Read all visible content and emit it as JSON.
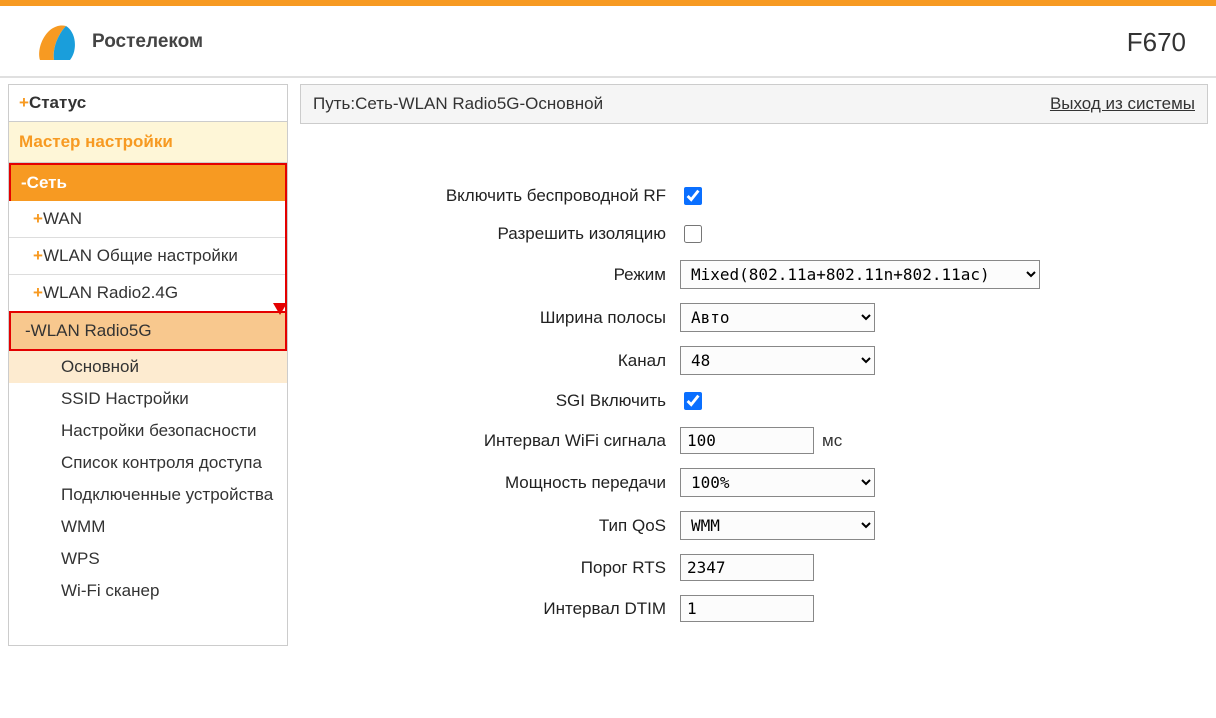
{
  "brand": "Ростелеком",
  "model": "F670",
  "sidebar": {
    "status": "Статус",
    "wizard": "Мастер настройки",
    "network": "Сеть",
    "wan": "WAN",
    "wlan_common": "WLAN Общие настройки",
    "wlan24": "WLAN Radio2.4G",
    "wlan5g": "WLAN Radio5G",
    "leaves": {
      "basic": "Основной",
      "ssid": "SSID Настройки",
      "security": "Настройки безопасности",
      "acl": "Список контроля доступа",
      "devices": "Подключенные устройства",
      "wmm": "WMM",
      "wps": "WPS",
      "scanner": "Wi-Fi сканер"
    }
  },
  "breadcrumb": "Путь:Сеть-WLAN Radio5G-Основной",
  "logout": "Выход из системы",
  "labels": {
    "rf": "Включить беспроводной RF",
    "isolation": "Разрешить изоляцию",
    "mode": "Режим",
    "bandwidth": "Ширина полосы",
    "channel": "Канал",
    "sgi": "SGI Включить",
    "beacon": "Интервал WiFi сигнала",
    "beacon_unit": "мс",
    "tx_power": "Мощность передачи",
    "qos": "Тип QoS",
    "rts": "Порог RTS",
    "dtim": "Интервал DTIM"
  },
  "values": {
    "rf": true,
    "isolation": false,
    "mode": "Mixed(802.11a+802.11n+802.11ac)",
    "bandwidth": "Авто",
    "channel": "48",
    "sgi": true,
    "beacon": "100",
    "tx_power": "100%",
    "qos": "WMM",
    "rts": "2347",
    "dtim": "1"
  }
}
